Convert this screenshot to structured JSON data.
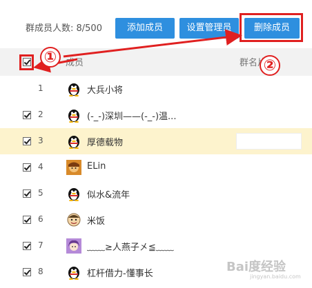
{
  "toolbar": {
    "member_count": "群成员人数: 8/500",
    "add_label": "添加成员",
    "admin_label": "设置管理员",
    "delete_label": "删除成员"
  },
  "table_header": {
    "member": "成员",
    "card": "群名片"
  },
  "annotations": {
    "step1": "①",
    "step2": "②"
  },
  "members": [
    {
      "num": "1",
      "name": "大兵小将",
      "checked": false,
      "avatar": "qq-penguin-icon"
    },
    {
      "num": "2",
      "name": "(-_-)深圳——(-_-)温...",
      "checked": true,
      "avatar": "qq-penguin-icon"
    },
    {
      "num": "3",
      "name": "厚德载物",
      "checked": true,
      "avatar": "qq-penguin-icon"
    },
    {
      "num": "4",
      "name": "ELin",
      "checked": true,
      "avatar": "cartoon-avatar-icon"
    },
    {
      "num": "5",
      "name": "似水&流年",
      "checked": true,
      "avatar": "qq-penguin-icon"
    },
    {
      "num": "6",
      "name": "米饭",
      "checked": true,
      "avatar": "cartoon-face-icon"
    },
    {
      "num": "7",
      "name": "﹏﹏≥人燕子㐅≦﹏﹏",
      "checked": true,
      "avatar": "anime-girl-icon"
    },
    {
      "num": "8",
      "name": "杠杆借力-懂事长",
      "checked": true,
      "avatar": "qq-penguin-icon"
    }
  ],
  "watermark": {
    "text": "Bai度经验",
    "sub": "jingyan.baidu.com"
  },
  "colors": {
    "button": "#2e8fdf",
    "highlight_row": "#fdf3cd",
    "annotation": "#e02020",
    "header_bg": "#f2f2f2"
  }
}
